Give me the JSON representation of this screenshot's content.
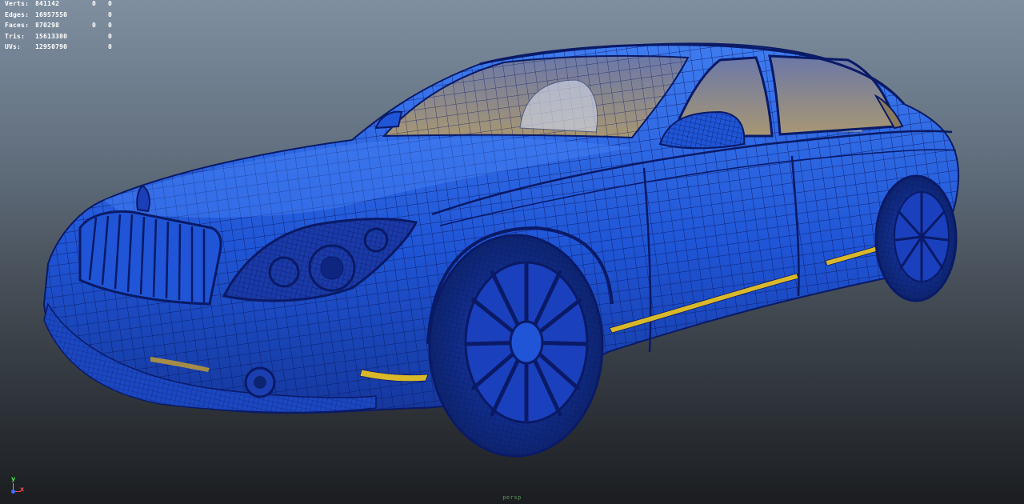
{
  "viewport": {
    "camera_label": "persp"
  },
  "hud": {
    "rows": [
      {
        "label": "Verts:",
        "c1": "841142",
        "c2": "0",
        "c3": "0"
      },
      {
        "label": "Edges:",
        "c1": "16957550",
        "c2": "",
        "c3": "0"
      },
      {
        "label": "Faces:",
        "c1": "870298",
        "c2": "0",
        "c3": "0"
      },
      {
        "label": "Tris:",
        "c1": "15613380",
        "c2": "",
        "c3": "0"
      },
      {
        "label": "UVs:",
        "c1": "12950790",
        "c2": "",
        "c3": "0"
      }
    ]
  },
  "axis_gizmo": {
    "y": "y",
    "x": "x"
  },
  "colors": {
    "paint": "#1f55d6",
    "paint_dark": "#0d2a8c",
    "wire": "#0a1a66",
    "trim": "#d9b82a",
    "glass": "#9a8a70"
  }
}
